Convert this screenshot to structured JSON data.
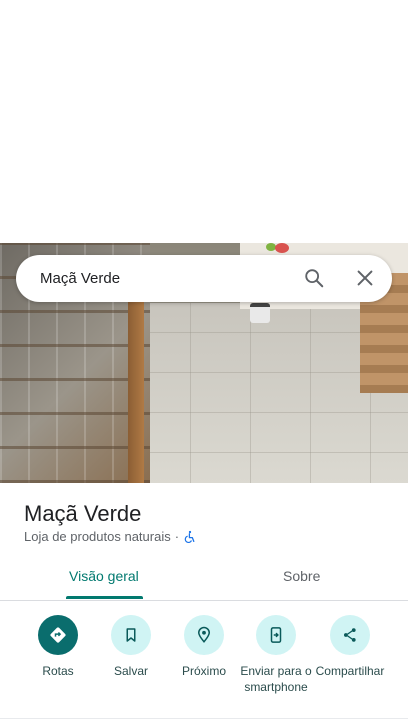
{
  "search": {
    "query": "Maçã Verde"
  },
  "place": {
    "name": "Maçã Verde",
    "category": "Loja de produtos naturais",
    "separator": "·",
    "accessibility_icon": "wheelchair-icon"
  },
  "tabs": [
    {
      "label": "Visão geral",
      "active": true
    },
    {
      "label": "Sobre",
      "active": false
    }
  ],
  "actions": [
    {
      "label": "Rotas",
      "icon": "directions-icon",
      "primary": true
    },
    {
      "label": "Salvar",
      "icon": "bookmark-icon",
      "primary": false
    },
    {
      "label": "Próximo",
      "icon": "nearby-icon",
      "primary": false
    },
    {
      "label": "Enviar para o smartphone",
      "icon": "send-to-phone-icon",
      "primary": false
    },
    {
      "label": "Compartilhar",
      "icon": "share-icon",
      "primary": false
    }
  ],
  "colors": {
    "accent": "#01796f",
    "primary_action": "#0a6d6d",
    "action_bg": "#d0f4f4",
    "accessibility": "#1a73e8"
  }
}
